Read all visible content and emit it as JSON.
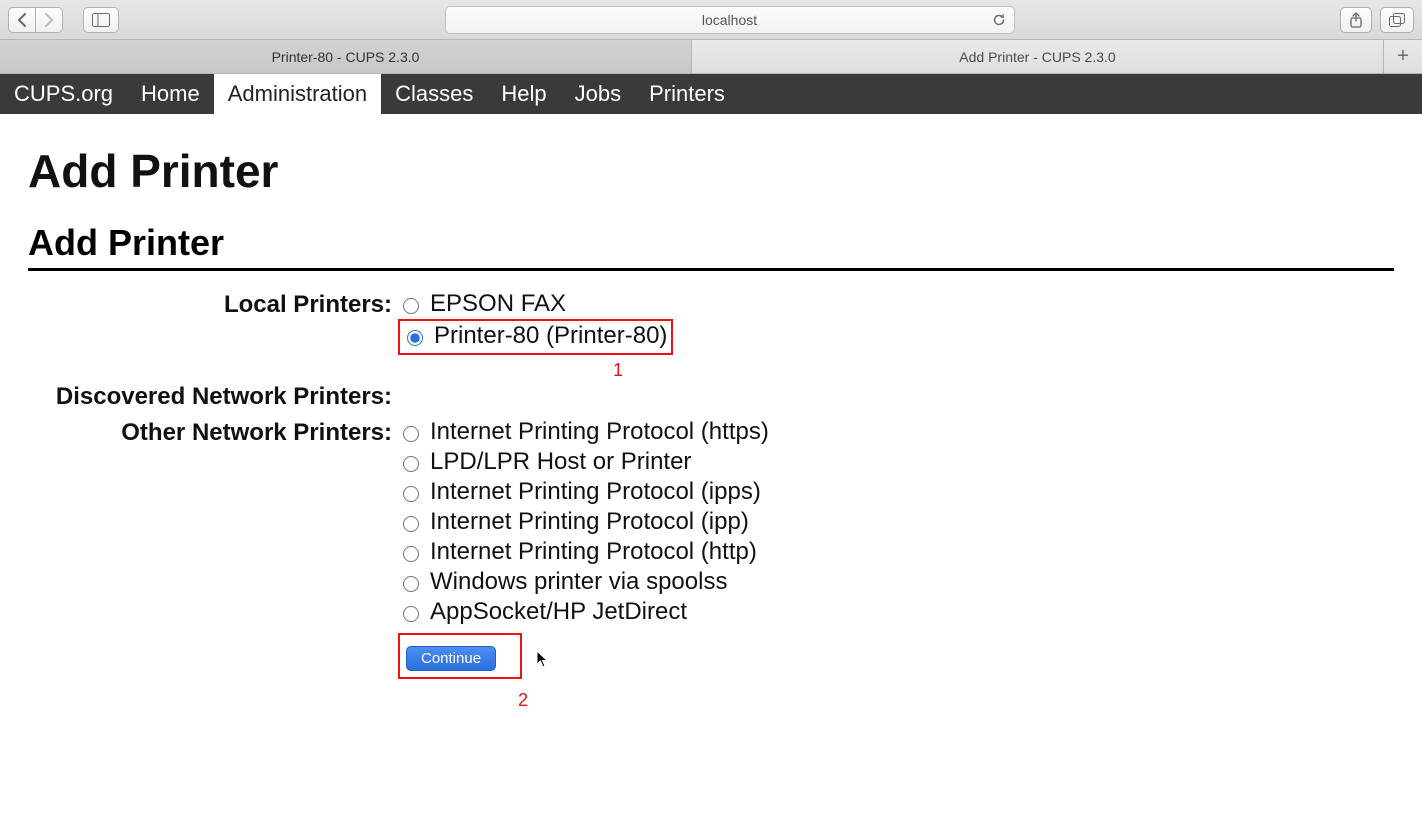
{
  "browser": {
    "url": "localhost",
    "tabs": [
      {
        "title": "Printer-80 - CUPS 2.3.0",
        "active": true
      },
      {
        "title": "Add Printer - CUPS 2.3.0",
        "active": false
      }
    ]
  },
  "nav": {
    "items": [
      {
        "label": "CUPS.org",
        "active": false
      },
      {
        "label": "Home",
        "active": false
      },
      {
        "label": "Administration",
        "active": true
      },
      {
        "label": "Classes",
        "active": false
      },
      {
        "label": "Help",
        "active": false
      },
      {
        "label": "Jobs",
        "active": false
      },
      {
        "label": "Printers",
        "active": false
      }
    ]
  },
  "page": {
    "heading1": "Add Printer",
    "heading2": "Add Printer",
    "sections": {
      "local_label": "Local Printers:",
      "discovered_label": "Discovered Network Printers:",
      "other_label": "Other Network Printers:"
    },
    "local_printers": [
      {
        "label": "EPSON FAX",
        "selected": false
      },
      {
        "label": "Printer-80 (Printer-80)",
        "selected": true
      }
    ],
    "other_printers": [
      {
        "label": "Internet Printing Protocol (https)"
      },
      {
        "label": "LPD/LPR Host or Printer"
      },
      {
        "label": "Internet Printing Protocol (ipps)"
      },
      {
        "label": "Internet Printing Protocol (ipp)"
      },
      {
        "label": "Internet Printing Protocol (http)"
      },
      {
        "label": "Windows printer via spoolss"
      },
      {
        "label": "AppSocket/HP JetDirect"
      }
    ],
    "continue_label": "Continue",
    "callouts": {
      "one": "1",
      "two": "2"
    }
  }
}
